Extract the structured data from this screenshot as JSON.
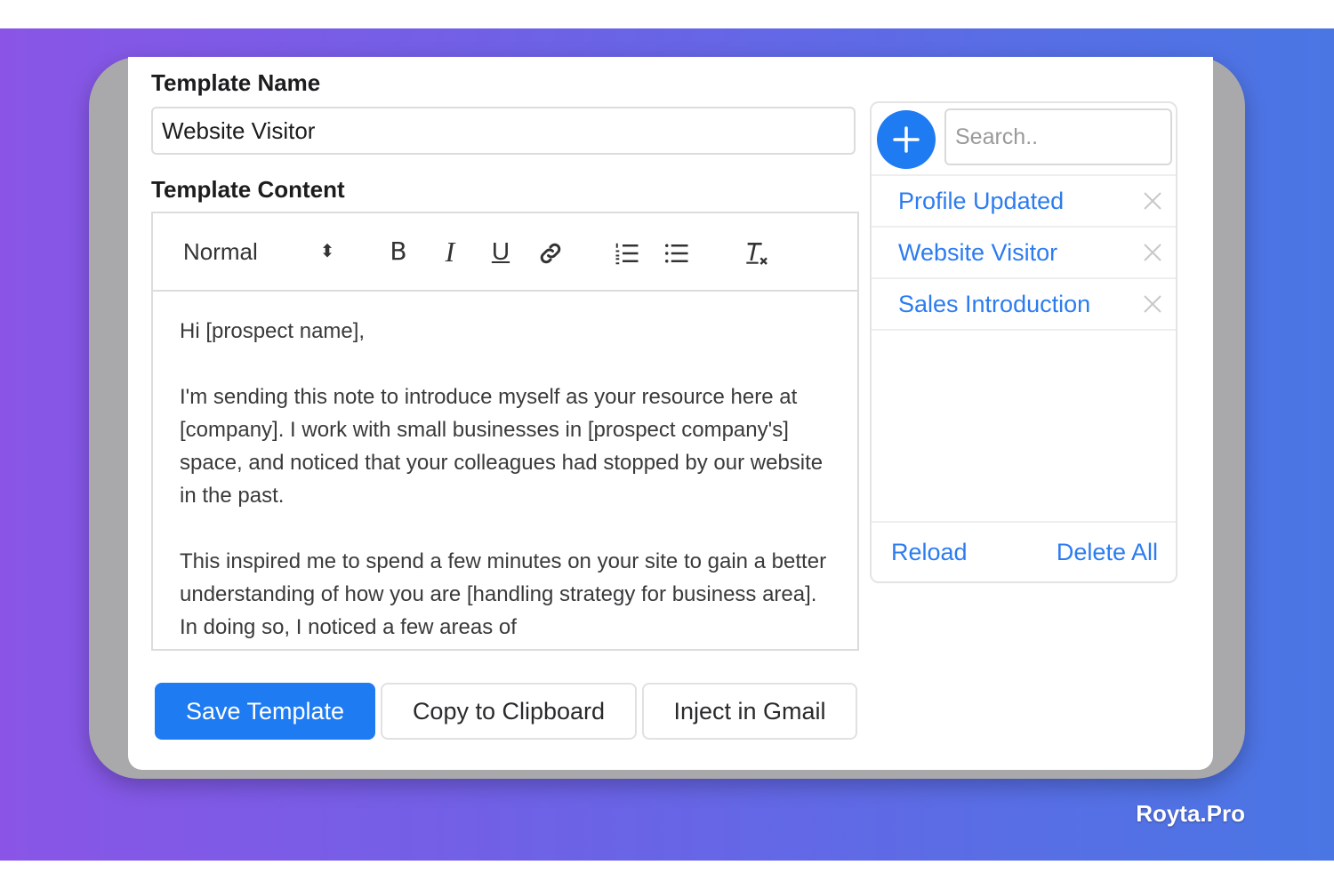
{
  "form": {
    "name_label": "Template Name",
    "name_value": "Website Visitor",
    "content_label": "Template Content"
  },
  "toolbar": {
    "format_label": "Normal",
    "format_arrows": "⬍",
    "bold": "B",
    "italic": "I",
    "underline": "U"
  },
  "content": {
    "paragraphs": [
      "Hi [prospect name],",
      "I'm sending this note to introduce myself as your resource here at [company]. I work with small businesses in [prospect company's] space, and noticed that your colleagues had stopped by our website in the past.",
      "This inspired me to spend a few minutes on your site to gain a better understanding of how you are [handling strategy for business area]. In doing so, I noticed a few areas of"
    ]
  },
  "actions": {
    "save": "Save Template",
    "copy": "Copy to Clipboard",
    "inject": "Inject in Gmail"
  },
  "sidebar": {
    "search_placeholder": "Search..",
    "items": [
      {
        "label": "Profile Updated"
      },
      {
        "label": "Website Visitor"
      },
      {
        "label": "Sales Introduction"
      }
    ],
    "reload": "Reload",
    "delete_all": "Delete All"
  },
  "watermark": "Royta.Pro",
  "colors": {
    "accent": "#1e7bf2",
    "link": "#2c7cf0",
    "gradient_start": "#8a55e6",
    "gradient_end": "#4a76e4"
  },
  "icons": [
    "plus-icon",
    "link-icon",
    "ordered-list-icon",
    "bullet-list-icon",
    "clear-format-icon",
    "close-icon"
  ]
}
